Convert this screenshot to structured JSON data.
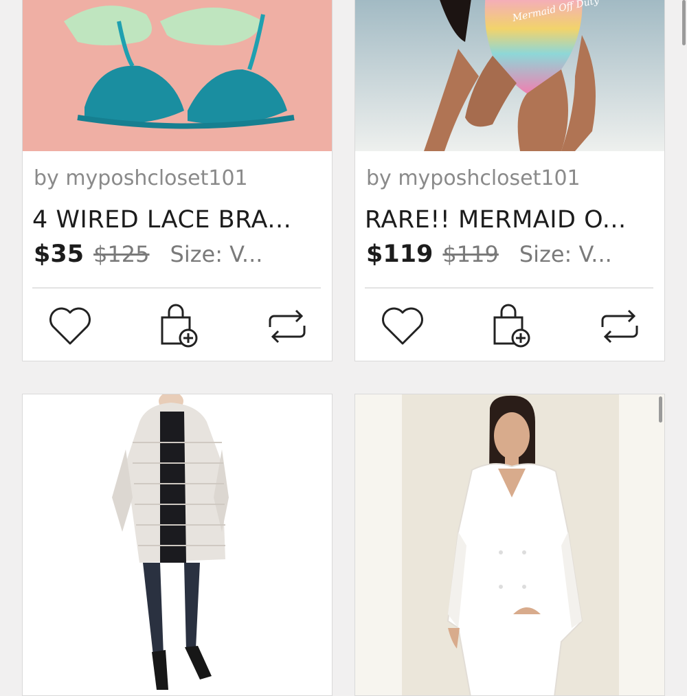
{
  "listings": [
    {
      "seller": "by myposhcloset101",
      "title": "4 WIRED LACE BRA...",
      "price": "$35",
      "original_price": "$125",
      "size": "Size: V...",
      "image": "bras-photo"
    },
    {
      "seller": "by myposhcloset101",
      "title": "RARE!! MERMAID O...",
      "price": "$119",
      "original_price": "$119",
      "size": "Size: V...",
      "image": "rainbow-swimsuit-photo",
      "swimsuit_text": "Mermaid Off Duty"
    },
    {
      "image": "puffer-coat-photo"
    },
    {
      "image": "white-coat-photo"
    }
  ],
  "actions": {
    "like": "heart-icon",
    "add_to_bundle": "bag-plus-icon",
    "share": "share-icon"
  },
  "colors": {
    "page_background": "#f1f0f0",
    "card_border": "#d9d9d9",
    "price_text": "#1c1c1c",
    "muted_text": "#8a8a8a"
  }
}
